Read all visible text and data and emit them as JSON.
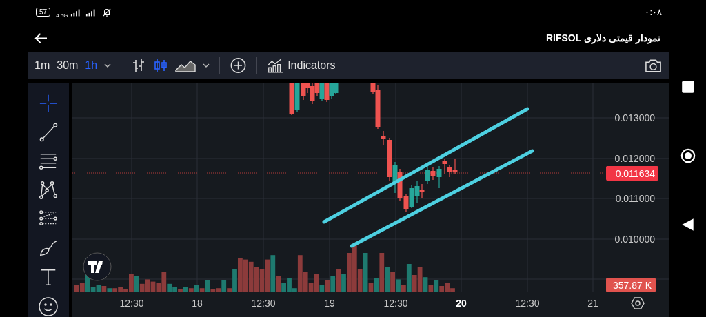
{
  "status_bar": {
    "battery": "57",
    "network": "4.5G",
    "time": "۰:۰۸"
  },
  "header": {
    "title": "نمودار قیمتی دلاری RIFSOL"
  },
  "toolbar": {
    "intervals": [
      {
        "label": "1m",
        "selected": false
      },
      {
        "label": "30m",
        "selected": false
      },
      {
        "label": "1h",
        "selected": true
      }
    ],
    "chart_styles": [
      {
        "kind": "bars",
        "selected": false
      },
      {
        "kind": "candles",
        "selected": true
      },
      {
        "kind": "area",
        "selected": false
      }
    ],
    "indicators_label": "Indicators"
  },
  "drawing_tools": [
    {
      "kind": "crosshair",
      "selected": true
    },
    {
      "kind": "line",
      "selected": false
    },
    {
      "kind": "parallel",
      "selected": false
    },
    {
      "kind": "pattern",
      "selected": false
    },
    {
      "kind": "fib",
      "selected": false
    },
    {
      "kind": "brush",
      "selected": false
    },
    {
      "kind": "text",
      "selected": false
    },
    {
      "kind": "emoji",
      "selected": false
    }
  ],
  "price_axis": {
    "labels": [
      "0.013000",
      "0.012000",
      "0.011000",
      "0.010000"
    ],
    "current_price": "0.011634",
    "volume": "357.87 K"
  },
  "time_axis": [
    {
      "label": "12:30",
      "bold": false
    },
    {
      "label": "18",
      "bold": false
    },
    {
      "label": "12:30",
      "bold": false
    },
    {
      "label": "19",
      "bold": false
    },
    {
      "label": "12:30",
      "bold": false
    },
    {
      "label": "20",
      "bold": true
    },
    {
      "label": "12:30",
      "bold": false
    },
    {
      "label": "21",
      "bold": false
    }
  ]
}
